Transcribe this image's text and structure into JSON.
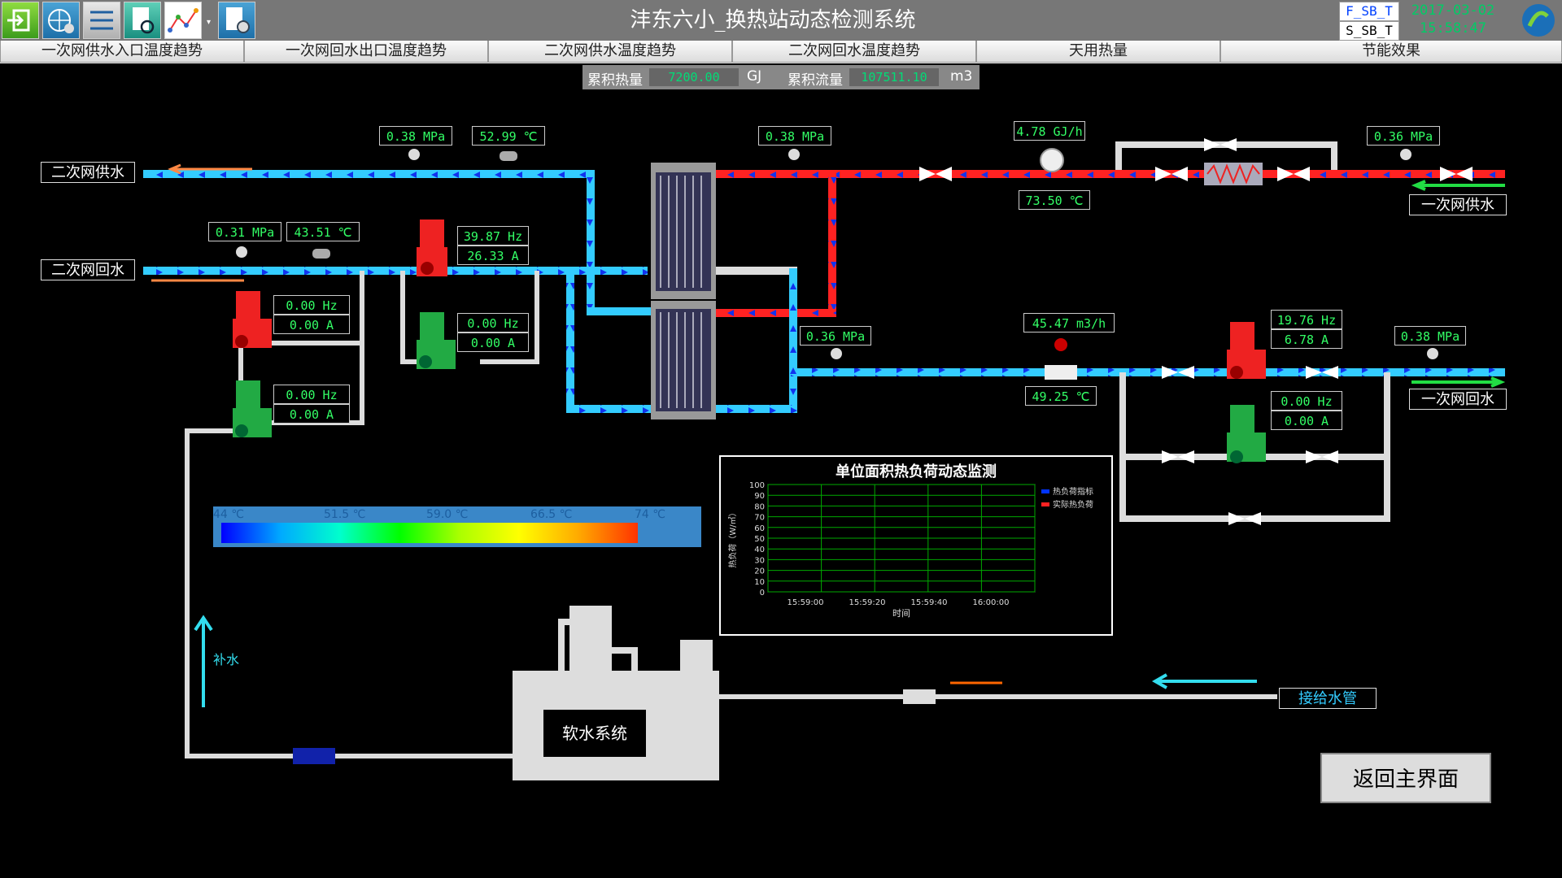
{
  "header": {
    "title": "沣东六小_换热站动态检测系统",
    "tag1": "F_SB_T",
    "tag2": "S_SB_T",
    "date": "2017-03-02",
    "time": "15:58:47"
  },
  "toolbar_icons": [
    "exit-icon",
    "globe-gear-icon",
    "list-settings-icon",
    "document-search-icon",
    "trend-network-icon",
    "document-settings-icon"
  ],
  "nav": [
    "一次网供水入口温度趋势",
    "一次网回水出口温度趋势",
    "二次网供水温度趋势",
    "二次网回水温度趋势",
    "天用热量",
    "节能效果"
  ],
  "accum": {
    "heat_label": "累积热量",
    "heat_value": "7200.00",
    "heat_unit": "GJ",
    "flow_label": "累积流量",
    "flow_value": "107511.10",
    "flow_unit": "m3"
  },
  "pipes": {
    "secondary_supply": "二次网供水",
    "secondary_return": "二次网回水",
    "primary_supply": "一次网供水",
    "primary_return": "一次网回水",
    "makeup": "补水",
    "inlet": "接给水管"
  },
  "readings": {
    "ss_pressure": "0.38 MPa",
    "ss_temp": "52.99 ℃",
    "ps_pressure_left": "0.38 MPa",
    "ps_heat_rate": "4.78 GJ/h",
    "ps_temp": "73.50 ℃",
    "ps_pressure_right": "0.36 MPa",
    "sr_pressure": "0.31 MPa",
    "sr_temp": "43.51 ℃",
    "pump1_hz": "39.87 Hz",
    "pump1_a": "26.33 A",
    "pump2_hz": "0.00 Hz",
    "pump2_a": "0.00 A",
    "pump3_hz": "0.00 Hz",
    "pump3_a": "0.00 A",
    "pump4_hz": "0.00 Hz",
    "pump4_a": "0.00 A",
    "pr_pressure_left": "0.36 MPa",
    "pr_flow": "45.47 m3/h",
    "pr_temp": "49.25 ℃",
    "ppump1_hz": "19.76 Hz",
    "ppump1_a": "6.78 A",
    "ppump2_hz": "0.00 Hz",
    "ppump2_a": "0.00 A",
    "pr_pressure_right": "0.38 MPa"
  },
  "color_scale": [
    "44 ℃",
    "51.5 ℃",
    "59.0 ℃",
    "66.5 ℃",
    "74 ℃"
  ],
  "soft_water": "软水系统",
  "back_button": "返回主界面",
  "colors": {
    "supply_hot": "#ff2222",
    "return_cold": "#33ccff",
    "pipe": "#dddddd",
    "pump_on": "#ee2222",
    "pump_off": "#22aa44"
  },
  "chart_data": {
    "type": "line",
    "title": "单位面积热负荷动态监测",
    "xlabel": "时间",
    "ylabel": "热负荷（W/㎡）",
    "ylim": [
      0,
      100
    ],
    "yticks": [
      "100",
      "90",
      "80",
      "70",
      "60",
      "50",
      "40",
      "30",
      "20",
      "10",
      "0"
    ],
    "xticks": [
      "15:59:00",
      "15:59:20",
      "15:59:40",
      "16:00:00"
    ],
    "series": [
      {
        "name": "热负荷指标",
        "color": "#0033ff",
        "values": []
      },
      {
        "name": "实际热负荷",
        "color": "#ff2222",
        "values": []
      }
    ],
    "grid": true,
    "legend": "top-right"
  }
}
